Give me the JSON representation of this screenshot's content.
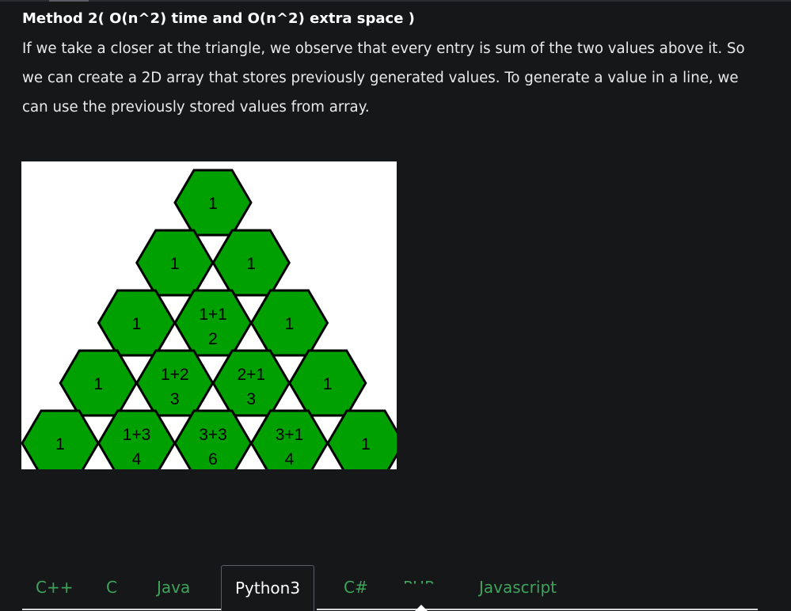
{
  "article": {
    "heading": "Method 2( O(n^2) time and O(n^2) extra space )",
    "paragraph": "If we take a closer at the triangle, we observe that every entry is sum of the two values above it. So we can create a 2D array that stores previously generated values. To generate a value in a line, we can use the previously stored values from array."
  },
  "figure": {
    "hex_color": "#00a000",
    "rows": [
      [
        {
          "top": "1",
          "bottom": ""
        }
      ],
      [
        {
          "top": "1",
          "bottom": ""
        },
        {
          "top": "1",
          "bottom": ""
        }
      ],
      [
        {
          "top": "1",
          "bottom": ""
        },
        {
          "top": "1+1",
          "bottom": "2"
        },
        {
          "top": "1",
          "bottom": ""
        }
      ],
      [
        {
          "top": "1",
          "bottom": ""
        },
        {
          "top": "1+2",
          "bottom": "3"
        },
        {
          "top": "2+1",
          "bottom": "3"
        },
        {
          "top": "1",
          "bottom": ""
        }
      ],
      [
        {
          "top": "1",
          "bottom": ""
        },
        {
          "top": "1+3",
          "bottom": "4"
        },
        {
          "top": "3+3",
          "bottom": "6"
        },
        {
          "top": "3+1",
          "bottom": "4"
        },
        {
          "top": "1",
          "bottom": ""
        }
      ]
    ]
  },
  "tabs": {
    "items": [
      "C++",
      "C",
      "Java",
      "Python3",
      "C#",
      "PHP",
      "Javascript"
    ],
    "active": "Python3",
    "accent_color": "#3ea35b"
  }
}
